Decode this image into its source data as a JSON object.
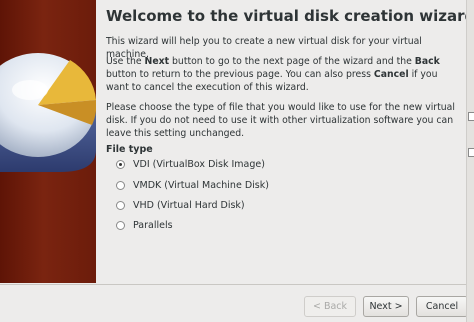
{
  "wizard": {
    "title": "Welcome to the virtual disk creation wizard",
    "intro": "This wizard will help you to create a new virtual disk for your virtual machine.",
    "nav_help": {
      "pre_next": "Use the ",
      "next_word": "Next",
      "mid_1": " button to go to the next page of the wizard and the ",
      "back_word": "Back",
      "mid_2": " button to return to the previous page. You can also press ",
      "cancel_word": "Cancel",
      "post": " if you want to cancel the execution of this wizard."
    },
    "type_help": "Please choose the type of file that you would like to use for the new virtual disk. If you do not need to use it with other virtualization software you can leave this setting unchanged.",
    "file_type_label": "File type",
    "options": [
      {
        "label": "VDI (VirtualBox Disk Image)",
        "checked": true
      },
      {
        "label": "VMDK (Virtual Machine Disk)",
        "checked": false
      },
      {
        "label": "VHD (Virtual Hard Disk)",
        "checked": false
      },
      {
        "label": "Parallels",
        "checked": false
      }
    ],
    "buttons": {
      "back": "< Back",
      "next": "Next >",
      "cancel": "Cancel"
    }
  }
}
